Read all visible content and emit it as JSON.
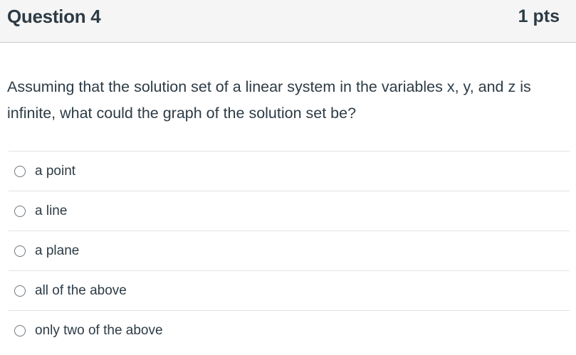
{
  "question": {
    "title": "Question 4",
    "points": "1 pts",
    "text": "Assuming that the solution set of a linear system in the variables x, y, and z is infinite, what could the graph of the solution set be?"
  },
  "answers": [
    {
      "label": "a point",
      "selected": false
    },
    {
      "label": "a line",
      "selected": false
    },
    {
      "label": "a plane",
      "selected": false
    },
    {
      "label": "all of the above",
      "selected": false
    },
    {
      "label": "only two of the above",
      "selected": false
    }
  ],
  "icons": {
    "radio": "radio-button-icon"
  },
  "colors": {
    "header_bg": "#f5f5f5",
    "text": "#2d3b45",
    "divider": "#dfe3e6"
  }
}
